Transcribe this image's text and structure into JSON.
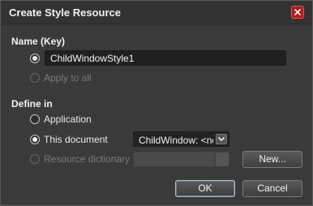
{
  "dialog": {
    "title": "Create Style Resource"
  },
  "name_section": {
    "heading": "Name (Key)",
    "name_value": "ChildWindowStyle1",
    "apply_to_all_label": "Apply to all"
  },
  "define_in_section": {
    "heading": "Define in",
    "application_label": "Application",
    "this_document_label": "This document",
    "this_document_selected": "ChildWindow: <no r",
    "resource_dictionary_label": "Resource dictionary"
  },
  "buttons": {
    "new_label": "New...",
    "ok_label": "OK",
    "cancel_label": "Cancel"
  },
  "icons": {
    "close": "close-icon",
    "dropdown": "chevron-down-icon"
  },
  "colors": {
    "close_button": "#b21a1a",
    "background": "#3a3a3a"
  }
}
